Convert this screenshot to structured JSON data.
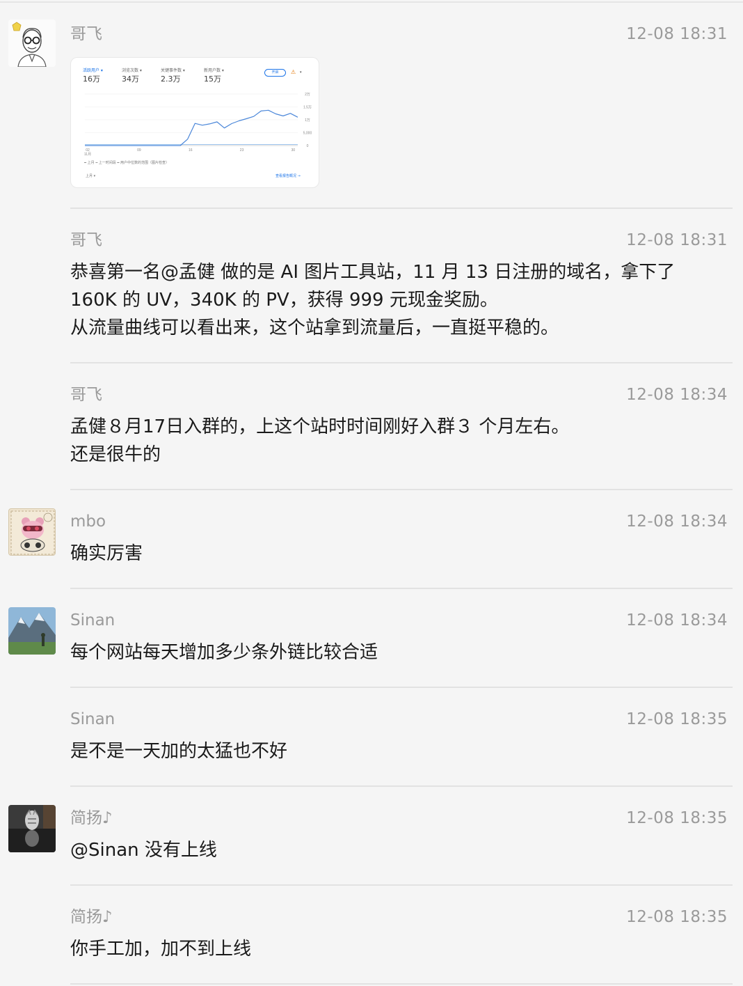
{
  "messages": [
    {
      "sender": "哥飞",
      "time": "12-08 18:31",
      "avatar": "avatar-gefei",
      "card": {
        "metrics": [
          {
            "label": "活跃用户 ▾",
            "value": "16万"
          },
          {
            "label": "浏览次数 ▾",
            "value": "34万"
          },
          {
            "label": "关键事件数 ▾",
            "value": "2.3万"
          },
          {
            "label": "新用户数 ▾",
            "value": "15万"
          }
        ],
        "pill": "开启",
        "y_ticks": [
          "2万",
          "1.5万",
          "1万",
          "5,000",
          "0"
        ],
        "x_ticks": [
          "02\n11月",
          "09",
          "16",
          "23",
          "30"
        ],
        "legend": "━ 上月  ╍ 上一时间段  ━ 用户中位数的范围（图片检查）",
        "footer_left": "上月 ▾",
        "footer_link": "查看报告概况 →"
      }
    },
    {
      "sender": "哥飞",
      "time": "12-08 18:31",
      "lines": [
        "恭喜第一名@孟健 做的是 AI 图片工具站，11 月 13 日注册的域名，拿下了",
        "160K 的 UV，340K 的 PV，获得 999 元现金奖励。",
        "从流量曲线可以看出来，这个站拿到流量后，一直挺平稳的。"
      ]
    },
    {
      "sender": "哥飞",
      "time": "12-08 18:34",
      "lines": [
        "孟健８月17日入群的，上这个站时时间刚好入群３ 个月左右。",
        "还是很牛的"
      ]
    },
    {
      "sender": "mbo",
      "time": "12-08 18:34",
      "avatar": "avatar-mbo",
      "lines": [
        "确实厉害"
      ]
    },
    {
      "sender": "Sinan",
      "time": "12-08 18:34",
      "avatar": "avatar-sinan",
      "lines": [
        "每个网站每天增加多少条外链比较合适"
      ]
    },
    {
      "sender": "Sinan",
      "time": "12-08 18:35",
      "lines": [
        "是不是一天加的太猛也不好"
      ]
    },
    {
      "sender": "简扬♪",
      "time": "12-08 18:35",
      "avatar": "avatar-jianyang",
      "lines": [
        "@Sinan 没有上线"
      ]
    },
    {
      "sender": "简扬♪",
      "time": "12-08 18:35",
      "lines": [
        "你手工加，加不到上线"
      ]
    }
  ],
  "chart_data": {
    "type": "line",
    "title": "",
    "x_tick_labels": [
      "02 11月",
      "09",
      "16",
      "23",
      "30"
    ],
    "y_tick_labels": [
      "2万",
      "1.5万",
      "1万",
      "5,000",
      "0"
    ],
    "ylim": [
      0,
      20000
    ],
    "series": [
      {
        "name": "上月",
        "color": "#4a86d9",
        "x": [
          1,
          2,
          3,
          4,
          5,
          6,
          7,
          8,
          9,
          10,
          11,
          12,
          13,
          14,
          15,
          16,
          17,
          18,
          19,
          20,
          21,
          22,
          23,
          24,
          25,
          26,
          27,
          28,
          29,
          30
        ],
        "values": [
          0,
          0,
          0,
          0,
          0,
          0,
          0,
          0,
          0,
          0,
          0,
          0,
          0,
          0,
          2500,
          8600,
          7900,
          8400,
          9200,
          6800,
          8500,
          9600,
          10400,
          11300,
          13400,
          13700,
          12300,
          11500,
          12500,
          11000
        ]
      }
    ]
  }
}
